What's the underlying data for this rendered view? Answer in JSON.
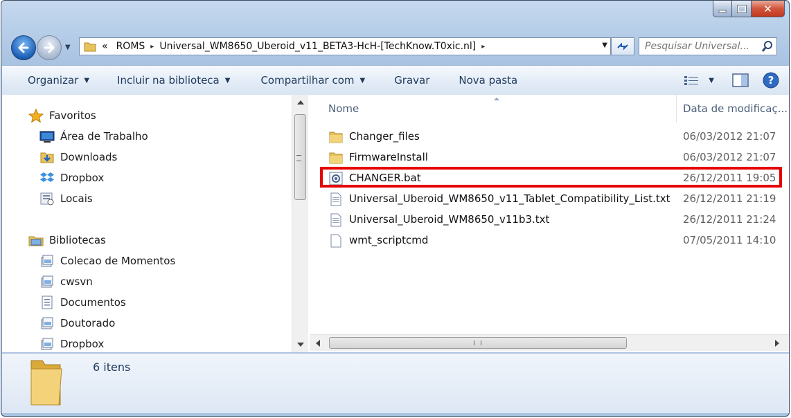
{
  "window": {
    "caption": {
      "minimize": "▁",
      "maximize": "▢",
      "close": "✕"
    }
  },
  "address_bar": {
    "overflow": "«",
    "crumbs": [
      "ROMS",
      "Universal_WM8650_Uberoid_v11_BETA3-HcH-[TechKnow.T0xic.nl]"
    ],
    "separator": "▸",
    "search_placeholder": "Pesquisar Universal..."
  },
  "toolbar": {
    "organize": "Organizar",
    "include_library": "Incluir na biblioteca",
    "share_with": "Compartilhar com",
    "burn": "Gravar",
    "new_folder": "Nova pasta"
  },
  "nav_pane": {
    "favorites": {
      "label": "Favoritos",
      "items": [
        "Área de Trabalho",
        "Downloads",
        "Dropbox",
        "Locais"
      ]
    },
    "libraries": {
      "label": "Bibliotecas",
      "items": [
        "Colecao de Momentos",
        "cwsvn",
        "Documentos",
        "Doutorado",
        "Dropbox"
      ]
    }
  },
  "file_list": {
    "columns": {
      "name": "Nome",
      "date": "Data de modificaç..."
    },
    "rows": [
      {
        "name": "Changer_files",
        "date": "06/03/2012 21:07",
        "icon": "folder-icon"
      },
      {
        "name": "FirmwareInstall",
        "date": "06/03/2012 21:07",
        "icon": "folder-icon"
      },
      {
        "name": "CHANGER.bat",
        "date": "26/12/2011 19:05",
        "icon": "batch-file-icon"
      },
      {
        "name": "Universal_Uberoid_WM8650_v11_Tablet_Compatibility_List.txt",
        "date": "26/12/2011 21:19",
        "icon": "text-file-icon"
      },
      {
        "name": "Universal_Uberoid_WM8650_v11b3.txt",
        "date": "26/12/2011 21:24",
        "icon": "text-file-icon"
      },
      {
        "name": "wmt_scriptcmd",
        "date": "07/05/2011 14:10",
        "icon": "blank-file-icon"
      }
    ],
    "highlight_color": "#e60000"
  },
  "details": {
    "count": "6 itens"
  }
}
